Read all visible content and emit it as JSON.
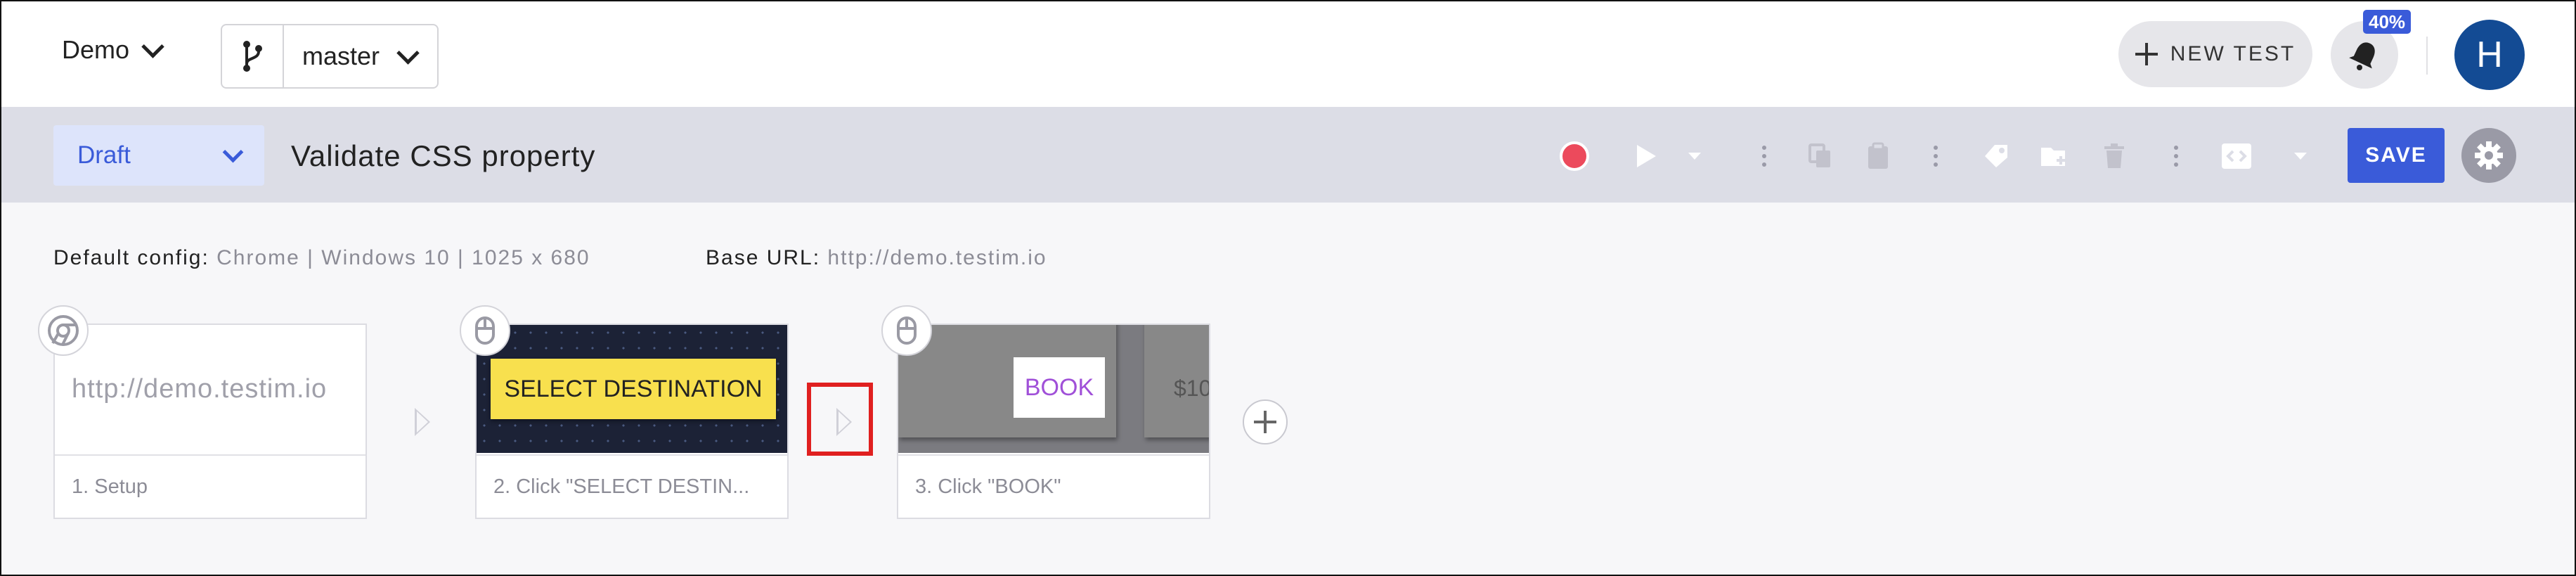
{
  "header": {
    "project": "Demo",
    "branch": "master",
    "new_test_label": "NEW TEST",
    "notification_badge": "40%",
    "avatar_initial": "H"
  },
  "toolbar": {
    "status": "Draft",
    "test_name": "Validate CSS property",
    "save_label": "SAVE"
  },
  "info": {
    "config_label": "Default config:",
    "config_value": "Chrome | Windows 10 | 1025 x 680",
    "base_url_label": "Base URL:",
    "base_url_value": "http://demo.testim.io"
  },
  "steps": [
    {
      "label": "1. Setup",
      "thumb_text": "http://demo.testim.io",
      "icon": "chrome-icon"
    },
    {
      "label": "2. Click \"SELECT DESTIN...",
      "thumb_text": "SELECT DESTINATION",
      "icon": "mouse-icon"
    },
    {
      "label": "3. Click \"BOOK\"",
      "thumb_text": "BOOK",
      "thumb_text_2": "$10",
      "icon": "mouse-icon"
    }
  ],
  "colors": {
    "accent": "#3a5bd9",
    "record": "#ec4a5c",
    "highlight": "#e02020",
    "select_button": "#f8e04e",
    "book_text": "#a050d8"
  }
}
